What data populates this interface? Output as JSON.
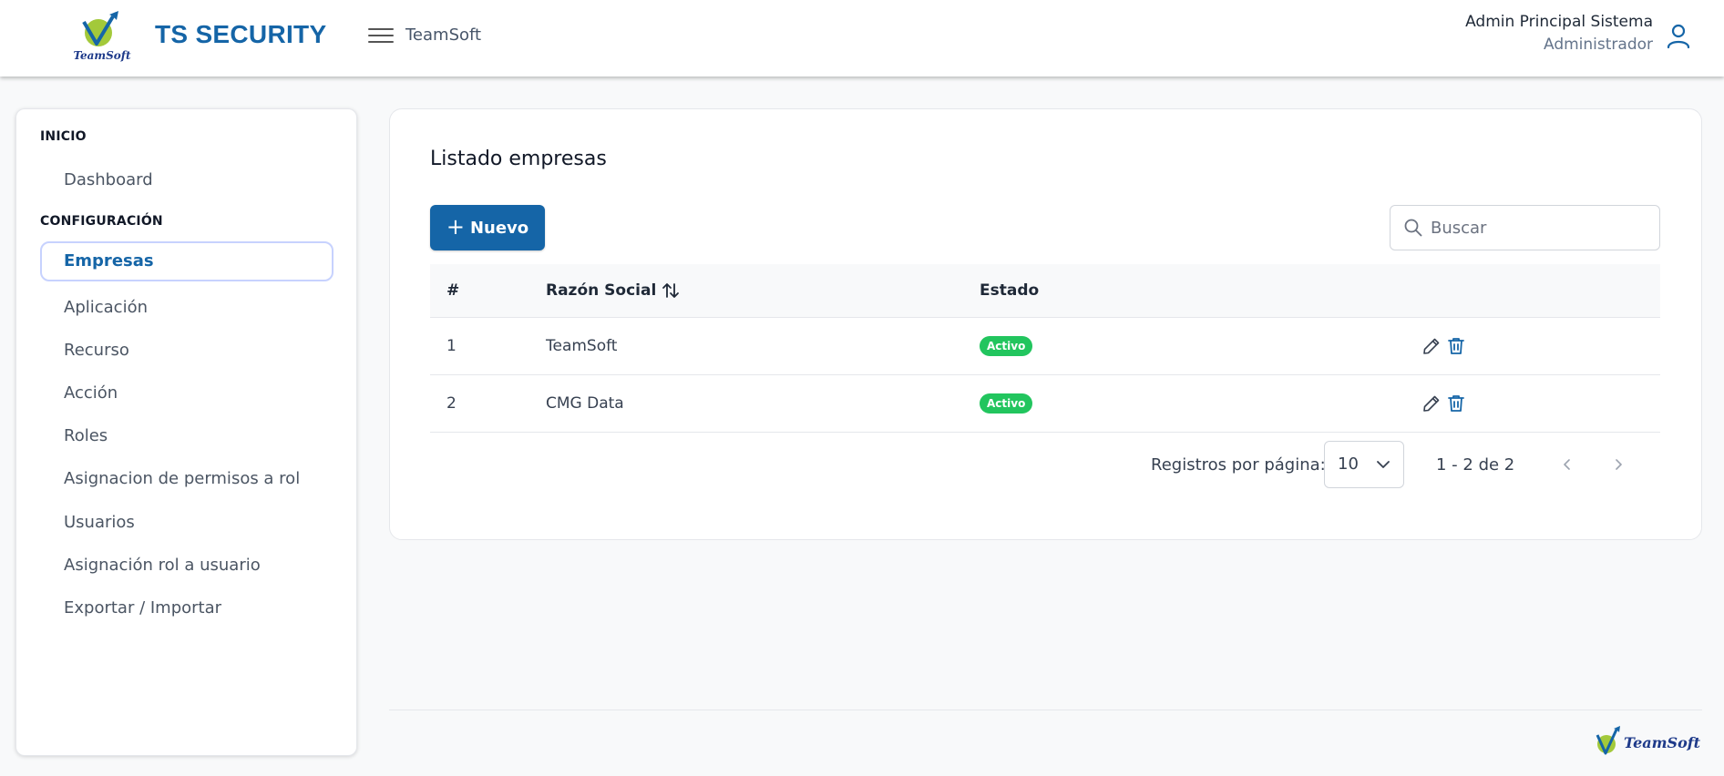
{
  "header": {
    "logo_text": "TeamSoft",
    "brand": "TS SECURITY",
    "breadcrumb": "TeamSoft",
    "user_name": "Admin Principal Sistema",
    "user_role": "Administrador"
  },
  "sidebar": {
    "sections": [
      {
        "title": "INICIO",
        "items": [
          {
            "label": "Dashboard",
            "active": false
          }
        ]
      },
      {
        "title": "CONFIGURACIÓN",
        "items": [
          {
            "label": "Empresas",
            "active": true
          },
          {
            "label": "Aplicación",
            "active": false
          },
          {
            "label": "Recurso",
            "active": false
          },
          {
            "label": "Acción",
            "active": false
          },
          {
            "label": "Roles",
            "active": false
          },
          {
            "label": "Asignacion de permisos a rol",
            "active": false
          },
          {
            "label": "Usuarios",
            "active": false
          },
          {
            "label": "Asignación rol a usuario",
            "active": false
          },
          {
            "label": "Exportar / Importar",
            "active": false
          }
        ]
      }
    ]
  },
  "main": {
    "title": "Listado empresas",
    "new_button_label": "Nuevo",
    "search": {
      "placeholder": "Buscar",
      "value": ""
    },
    "table": {
      "columns": [
        "#",
        "Razón Social",
        "Estado",
        ""
      ],
      "rows": [
        {
          "num": "1",
          "razon_social": "TeamSoft",
          "estado": "Activo"
        },
        {
          "num": "2",
          "razon_social": "CMG Data",
          "estado": "Activo"
        }
      ]
    },
    "pagination": {
      "label": "Registros por página:",
      "page_size": "10",
      "range": "1 - 2 de 2"
    }
  },
  "footer": {
    "logo_text": "TeamSoft"
  },
  "colors": {
    "brand": "#1565a7",
    "status_active": "#22c55e",
    "active_border": "#c7d2fe"
  },
  "icons": [
    "hamburger-menu-icon",
    "user-icon",
    "plus-icon",
    "search-icon",
    "sort-icon",
    "edit-icon",
    "trash-icon",
    "chevron-down-icon",
    "chevron-left-icon",
    "chevron-right-icon"
  ]
}
